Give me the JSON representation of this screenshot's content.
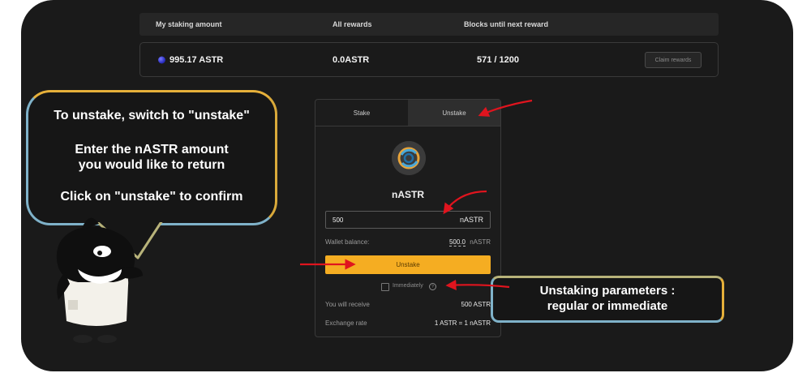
{
  "staking_table": {
    "headers": [
      "My staking amount",
      "All rewards",
      "Blocks until next reward"
    ],
    "row": {
      "staking_amount": "995.17 ASTR",
      "rewards": "0.0ASTR",
      "blocks": "571 / 1200",
      "claim_label": "Claim rewards"
    }
  },
  "panel": {
    "tabs": [
      {
        "label": "Stake",
        "active": false
      },
      {
        "label": "Unstake",
        "active": true
      }
    ],
    "token_name": "nASTR",
    "amount": {
      "value": "500",
      "unit": "nASTR"
    },
    "wallet_balance": {
      "label": "Wallet balance:",
      "value": "500.0",
      "unit": "nASTR"
    },
    "unstake_button": "Unstake",
    "immediately_label": "Immediately",
    "receive": {
      "label": "You will receive",
      "value": "500 ASTR"
    },
    "exchange": {
      "label": "Exchange rate",
      "value": "1 ASTR = 1 nASTR"
    }
  },
  "instructions": {
    "line1": "To unstake, switch to \"unstake\"",
    "line2a": "Enter the nASTR amount",
    "line2b": "you would like to return",
    "line3": "Click on \"unstake\" to confirm"
  },
  "params_callout": {
    "line1": "Unstaking parameters :",
    "line2": "regular or immediate"
  },
  "colors": {
    "background": "#1a1a1a",
    "accent_button": "#f5ad22",
    "arrow": "#e0141e",
    "callout_border_blue": "#7fb2c9",
    "callout_border_gold": "#e6b03a"
  }
}
